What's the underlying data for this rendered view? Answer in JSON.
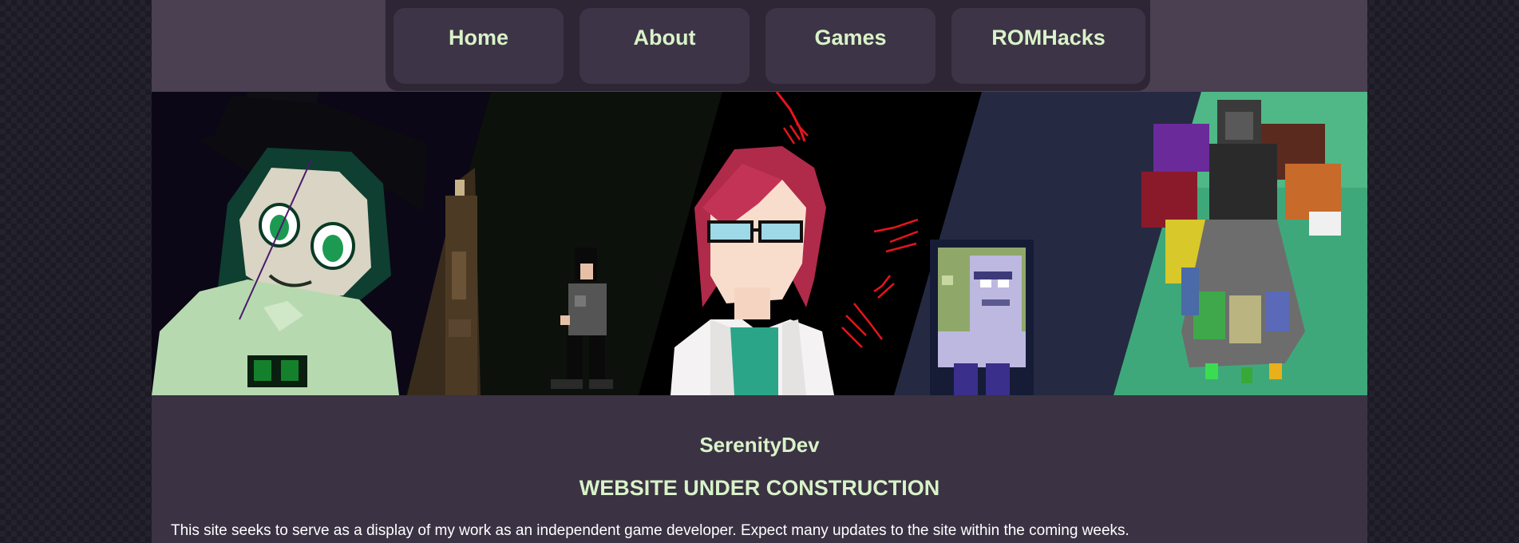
{
  "nav": {
    "items": [
      {
        "label": "Home"
      },
      {
        "label": "About"
      },
      {
        "label": "Games"
      },
      {
        "label": "ROMHacks"
      }
    ]
  },
  "banner": {
    "panels": [
      "top-hat-girl-character",
      "dark-room-pixel-character",
      "red-haired-scientist-character",
      "green-purple-pixel-creature",
      "shadow-figure-on-flower-island"
    ]
  },
  "main": {
    "site_name": "SerenityDev",
    "status_heading": "WEBSITE UNDER CONSTRUCTION",
    "description": "This site seeks to serve as a display of my work as an independent game developer. Expect many updates to the site within the coming weeks."
  },
  "colors": {
    "page_background": "#1c1a24",
    "header_background": "#4b3f52",
    "nav_background": "#2e2535",
    "nav_button": "#3e3447",
    "content_background": "#3b3243",
    "accent_text": "#d8f3c8"
  }
}
